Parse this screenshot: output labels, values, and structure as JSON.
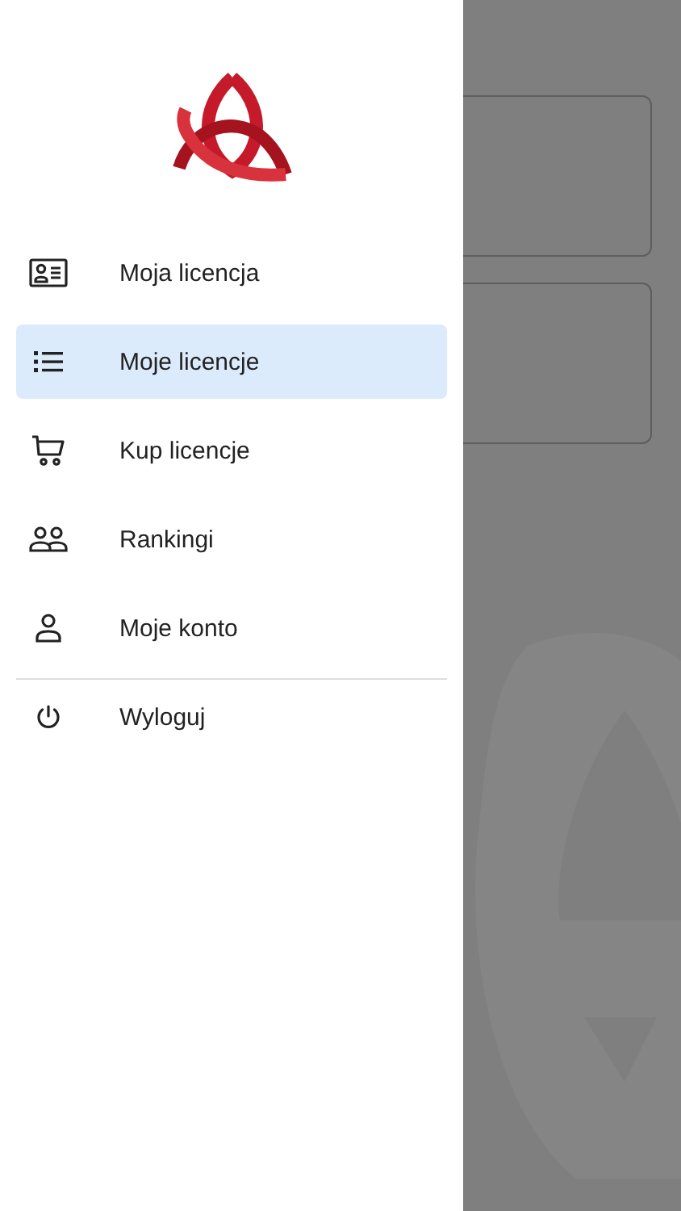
{
  "drawer": {
    "items": [
      {
        "label": "Moja licencja",
        "kind": "id-card",
        "selected": false
      },
      {
        "label": "Moje licencje",
        "kind": "list",
        "selected": true
      },
      {
        "label": "Kup licencje",
        "kind": "cart",
        "selected": false
      },
      {
        "label": "Rankingi",
        "kind": "people",
        "selected": false
      },
      {
        "label": "Moje konto",
        "kind": "person",
        "selected": false
      }
    ],
    "logout": {
      "label": "Wyloguj",
      "kind": "power"
    }
  }
}
